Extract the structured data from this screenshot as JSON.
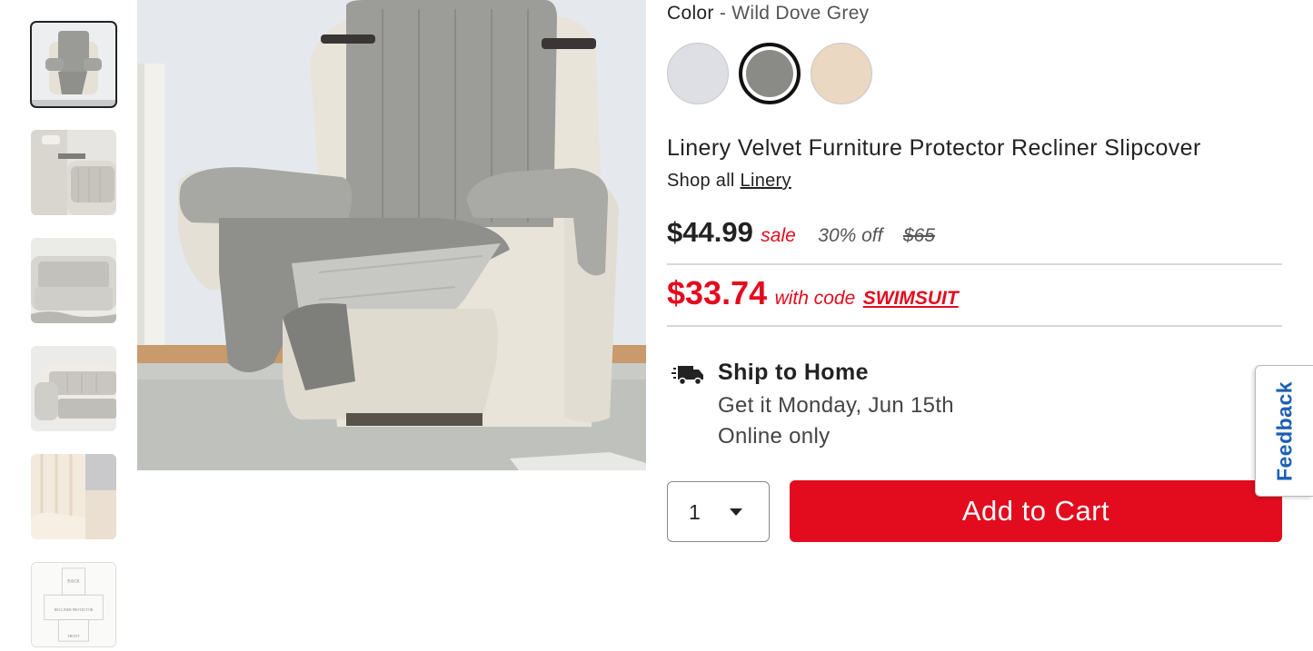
{
  "product": {
    "color_label": "Color",
    "color_separator": " - ",
    "color_value": "Wild Dove Grey",
    "swatches": [
      {
        "name": "Light Grey",
        "color": "#dedfe4"
      },
      {
        "name": "Wild Dove Grey",
        "color": "#8a8a86",
        "selected": true
      },
      {
        "name": "Beige",
        "color": "#ead8c2"
      }
    ],
    "title": "Linery Velvet Furniture Protector Recliner Slipcover",
    "shop_all_prefix": "Shop all",
    "brand": "Linery"
  },
  "pricing": {
    "sale_price": "$44.99",
    "sale_label": "sale",
    "percent_off": "30% off",
    "original_price": "$65",
    "code_price": "$33.74",
    "with_code_label": "with code",
    "promo_code": "SWIMSUIT"
  },
  "shipping": {
    "icon": "truck-icon",
    "title": "Ship to Home",
    "delivery": "Get it Monday, Jun 15th",
    "availability": "Online only"
  },
  "cart": {
    "quantity": "1",
    "add_label": "Add to Cart"
  },
  "feedback": {
    "label": "Feedback"
  },
  "thumbnails": [
    {
      "alt": "recliner cover front view",
      "active": true
    },
    {
      "alt": "armrest detail"
    },
    {
      "alt": "sofa with cover"
    },
    {
      "alt": "side view of cover"
    },
    {
      "alt": "velvet fabric close-up"
    },
    {
      "alt": "size diagram"
    }
  ],
  "size_diagram": {
    "top": "BACK",
    "middle": "RECLINER PROTECTOR",
    "bottom": "FRONT"
  },
  "colors": {
    "accent_red": "#e30b1e",
    "feedback_blue": "#1b5fb3"
  }
}
